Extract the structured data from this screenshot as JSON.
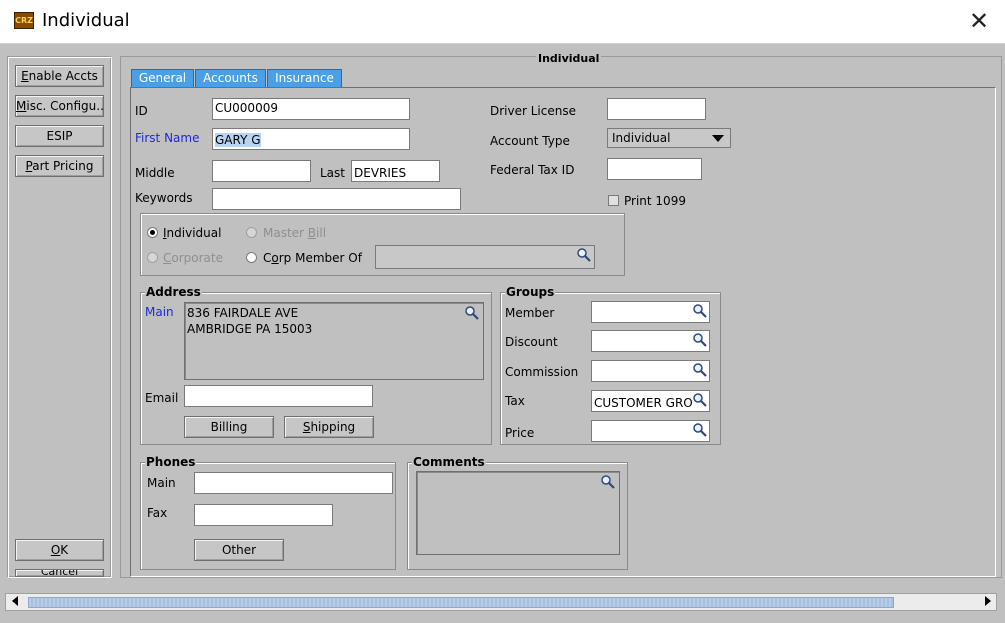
{
  "window": {
    "title": "Individual",
    "icon_text": "CRZ",
    "close_glyph": "✕"
  },
  "left_buttons": {
    "enable_accts": {
      "pre": "",
      "ul": "E",
      "post": "nable Accts"
    },
    "misc_config": {
      "pre": "",
      "ul": "M",
      "post": "isc. Configu..."
    },
    "esip": {
      "pre": "ESIP",
      "ul": "",
      "post": ""
    },
    "part_pricing": {
      "pre": "",
      "ul": "P",
      "post": "art Pricing"
    },
    "ok": {
      "pre": "",
      "ul": "O",
      "post": "K"
    },
    "cancel_partial": "Cancel"
  },
  "panel_title": "Individual",
  "tabs": [
    {
      "label": "General"
    },
    {
      "label": "Accounts"
    },
    {
      "label": "Insurance"
    }
  ],
  "form": {
    "id_label": "ID",
    "id_value": "CU000009",
    "first_name_label": "First Name",
    "first_name_value": "GARY G",
    "middle_label": "Middle",
    "middle_value": "",
    "last_label": "Last",
    "last_value": "DEVRIES",
    "keywords_label": "Keywords",
    "keywords_value": "",
    "driver_license_label": "Driver License",
    "driver_license_value": "",
    "account_type_label": "Account Type",
    "account_type_value": "Individual",
    "federal_tax_label": "Federal Tax ID",
    "federal_tax_value": "",
    "print_1099_label": "Print 1099"
  },
  "customer_type": {
    "individual_pre": "",
    "individual_ul": "I",
    "individual_post": "ndividual",
    "master_bill_pre": "Master ",
    "master_bill_ul": "B",
    "master_bill_post": "ill",
    "corporate_pre": "",
    "corporate_ul": "C",
    "corporate_post": "orporate",
    "corp_member_pre": "C",
    "corp_member_ul": "o",
    "corp_member_post": "rp Member Of",
    "corp_member_value": ""
  },
  "address": {
    "title": "Address",
    "main_label": "Main",
    "lines": [
      "836 FAIRDALE AVE",
      "AMBRIDGE PA 15003"
    ],
    "email_label": "Email",
    "email_value": "",
    "billing_label": "Billing",
    "shipping_pre": "",
    "shipping_ul": "S",
    "shipping_post": "hipping"
  },
  "groups": {
    "title": "Groups",
    "member_label": "Member",
    "member_value": "",
    "discount_label": "Discount",
    "discount_value": "",
    "commission_label": "Commission",
    "commission_value": "",
    "tax_label": "Tax",
    "tax_value": "CUSTOMER GRO",
    "price_label": "Price",
    "price_value": ""
  },
  "phones": {
    "title": "Phones",
    "main_label": "Main",
    "main_value": "",
    "fax_label": "Fax",
    "fax_value": "",
    "other_label": "Other"
  },
  "comments": {
    "title": "Comments",
    "value": ""
  },
  "colors": {
    "tab_blue": "#4a9fe6",
    "link_blue": "#1b2ad8",
    "panel_gray": "#c0c0c0"
  }
}
